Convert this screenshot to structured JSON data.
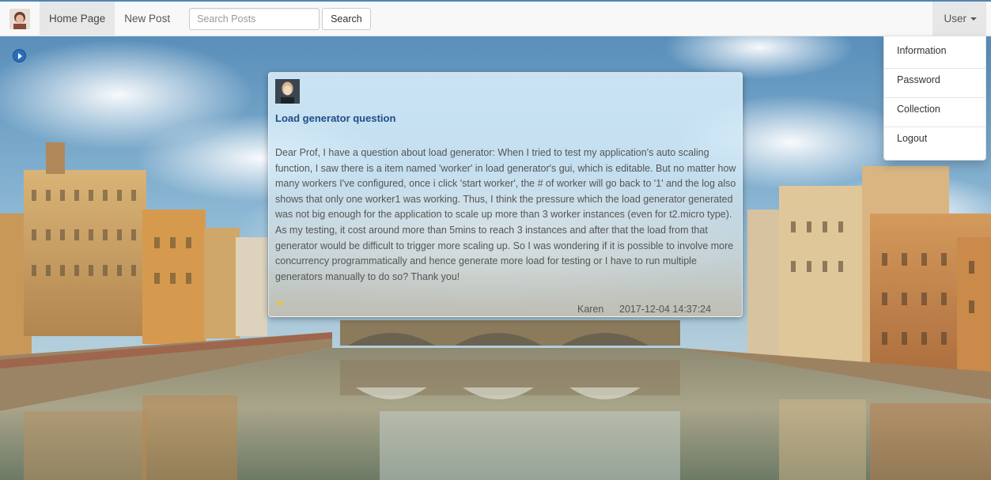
{
  "navbar": {
    "home_label": "Home Page",
    "new_post_label": "New Post",
    "search_placeholder": "Search Posts",
    "search_button_label": "Search",
    "user_label": "User"
  },
  "user_menu": {
    "items": [
      {
        "label": "Information"
      },
      {
        "label": "Password"
      },
      {
        "label": "Collection"
      },
      {
        "label": "Logout"
      }
    ]
  },
  "post": {
    "title": "Load generator question",
    "body": "Dear Prof, I have a question about load generator: When I tried to test my application's auto scaling function, I saw there is a item named 'worker' in load generator's gui, which is editable. But no matter how many workers I've configured, once i click 'start worker', the # of worker will go back to '1' and the log also shows that only one worker1 was working. Thus, I think the pressure which the load generator generated was not big enough for the application to scale up more than 3 worker instances (even for t2.micro type). As my testing, it cost around more than 5mins to reach 3 instances and after that the load from that generator would be difficult to trigger more scaling up. So I was wondering if it is possible to involve more concurrency programmatically and hence generate more load for testing or I have to run multiple generators manually to do so? Thank you!",
    "author": "Karen",
    "date": "2017-12-04 14:37:24",
    "star_icon": "★"
  },
  "icons": {
    "sidebar_toggle": "chevron-right-circle-icon",
    "collection": "star-icon",
    "brand": "user-avatar-logo"
  },
  "colors": {
    "title": "#1e4e86",
    "star": "#f5c518",
    "toggle": "#2a6ebb"
  }
}
